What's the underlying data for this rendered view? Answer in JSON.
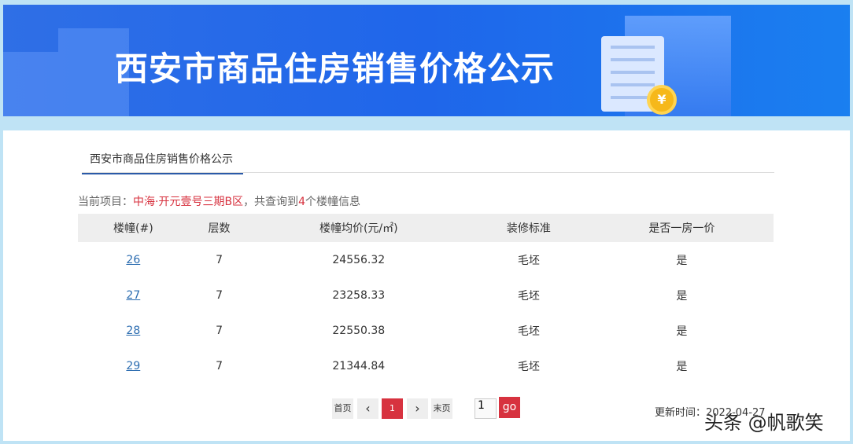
{
  "banner": {
    "title": "西安市商品住房销售价格公示",
    "coin": "¥"
  },
  "tab": {
    "label": "西安市商品住房销售价格公示"
  },
  "info": {
    "prefix": "当前项目：",
    "project": "中海·开元壹号三期B区",
    "mid": "，共查询到",
    "count": "4",
    "suffix": "个楼幢信息"
  },
  "table": {
    "headers": [
      "楼幢(#)",
      "层数",
      "楼幢均价(元/㎡)",
      "装修标准",
      "是否一房一价"
    ],
    "rows": [
      [
        "26",
        "7",
        "24556.32",
        "毛坯",
        "是"
      ],
      [
        "27",
        "7",
        "23258.33",
        "毛坯",
        "是"
      ],
      [
        "28",
        "7",
        "22550.38",
        "毛坯",
        "是"
      ],
      [
        "29",
        "7",
        "21344.84",
        "毛坯",
        "是"
      ]
    ]
  },
  "pager": {
    "first": "首页",
    "prev": "‹",
    "current": "1",
    "next": "›",
    "last": "末页",
    "input": "1",
    "go": "go"
  },
  "update": {
    "label": "更新时间：",
    "date": "2022-04-27"
  },
  "watermark": "头条 @帆歌笑"
}
